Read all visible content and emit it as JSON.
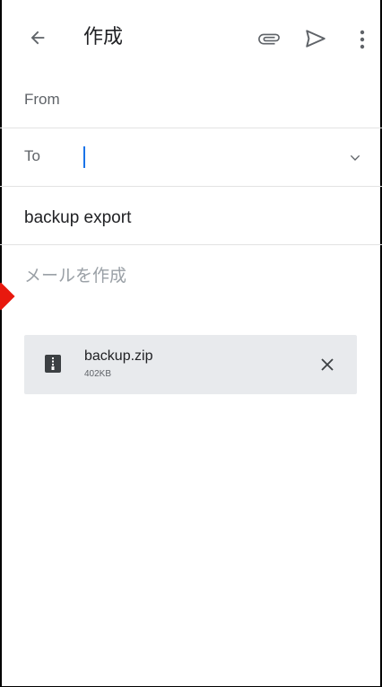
{
  "header": {
    "title": "作成"
  },
  "fields": {
    "from_label": "From",
    "to_label": "To",
    "subject": "backup export",
    "body_placeholder": "メールを作成"
  },
  "attachment": {
    "name": "backup.zip",
    "size": "402KB"
  },
  "icons": {
    "back": "arrow-left-icon",
    "attach": "paperclip-icon",
    "send": "send-icon",
    "more": "more-vert-icon",
    "expand": "chevron-down-icon",
    "file": "zip-file-icon",
    "remove": "close-icon"
  },
  "colors": {
    "cursor": "#1a73e8",
    "chip_bg": "#e8eaed",
    "marker": "#e8190e"
  }
}
